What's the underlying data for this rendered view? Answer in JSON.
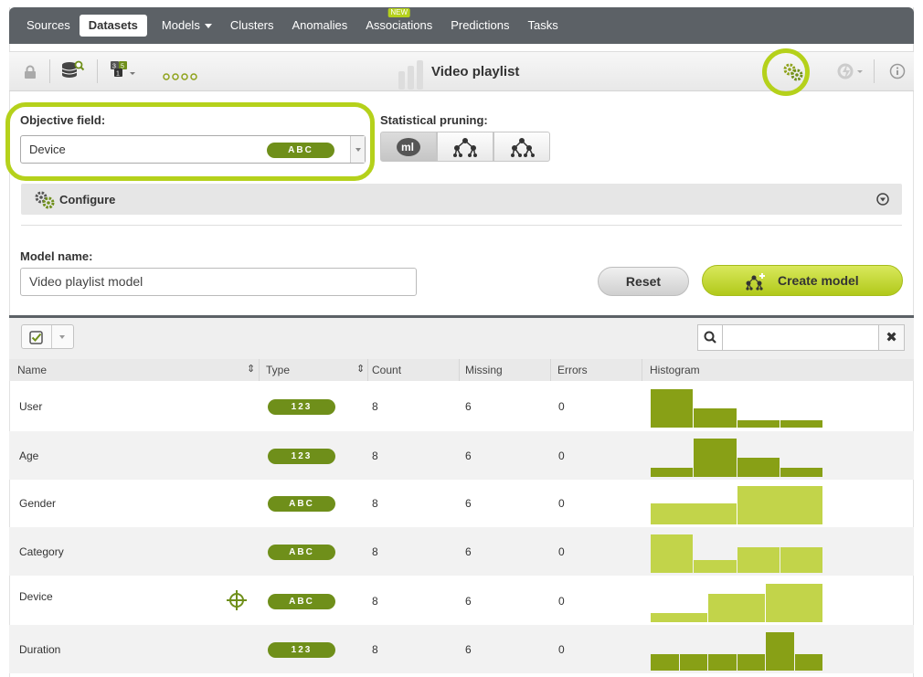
{
  "nav": {
    "items": [
      {
        "label": "Sources"
      },
      {
        "label": "Datasets",
        "active": true
      },
      {
        "label": "Models",
        "dropdown": true
      },
      {
        "label": "Clusters"
      },
      {
        "label": "Anomalies"
      },
      {
        "label": "Associations",
        "badge": "NEW"
      },
      {
        "label": "Predictions"
      },
      {
        "label": "Tasks"
      }
    ]
  },
  "toolbar": {
    "title": "Video playlist"
  },
  "objective": {
    "label": "Objective field:",
    "value": "Device",
    "type_tag": "ABC"
  },
  "pruning": {
    "label": "Statistical pruning:"
  },
  "configure": {
    "label": "Configure"
  },
  "model_name": {
    "label": "Model name:",
    "value": "Video playlist model"
  },
  "actions": {
    "reset": "Reset",
    "create": "Create model"
  },
  "table": {
    "columns": [
      "Name",
      "Type",
      "Count",
      "Missing",
      "Errors",
      "Histogram"
    ],
    "rows": [
      {
        "name": "User",
        "type": "123",
        "count": "8",
        "missing": "6",
        "errors": "0",
        "histogram": [
          1.0,
          0.5,
          0.2,
          0.2
        ]
      },
      {
        "name": "Age",
        "type": "123",
        "count": "8",
        "missing": "6",
        "errors": "0",
        "histogram": [
          0.25,
          1.0,
          0.5,
          0.25
        ]
      },
      {
        "name": "Gender",
        "type": "ABC",
        "count": "8",
        "missing": "6",
        "errors": "0",
        "histogram": [
          0.55,
          1.0
        ]
      },
      {
        "name": "Category",
        "type": "ABC",
        "count": "8",
        "missing": "6",
        "errors": "0",
        "histogram": [
          1.0,
          0.33,
          0.67,
          0.67
        ]
      },
      {
        "name": "Device",
        "type": "ABC",
        "count": "8",
        "missing": "6",
        "errors": "0",
        "objective": true,
        "histogram": [
          0.25,
          0.75,
          1.0
        ]
      },
      {
        "name": "Duration",
        "type": "123",
        "count": "8",
        "missing": "6",
        "errors": "0",
        "histogram": [
          0.43,
          0.43,
          0.43,
          0.43,
          1.0,
          0.43
        ]
      }
    ]
  },
  "colors": {
    "accent": "#b5d11b",
    "tag": "#6f8f1a",
    "hist_dark": "#88a016",
    "hist_light": "#c2d44a",
    "nav": "#5c6166"
  },
  "icons": [
    "lock-icon",
    "dataset-search-icon",
    "fields-icon",
    "dots-icon",
    "config-gears-icon",
    "one-click-icon",
    "info-icon",
    "gears-icon",
    "target-icon",
    "search-icon",
    "close-icon",
    "checkbox-icon"
  ]
}
